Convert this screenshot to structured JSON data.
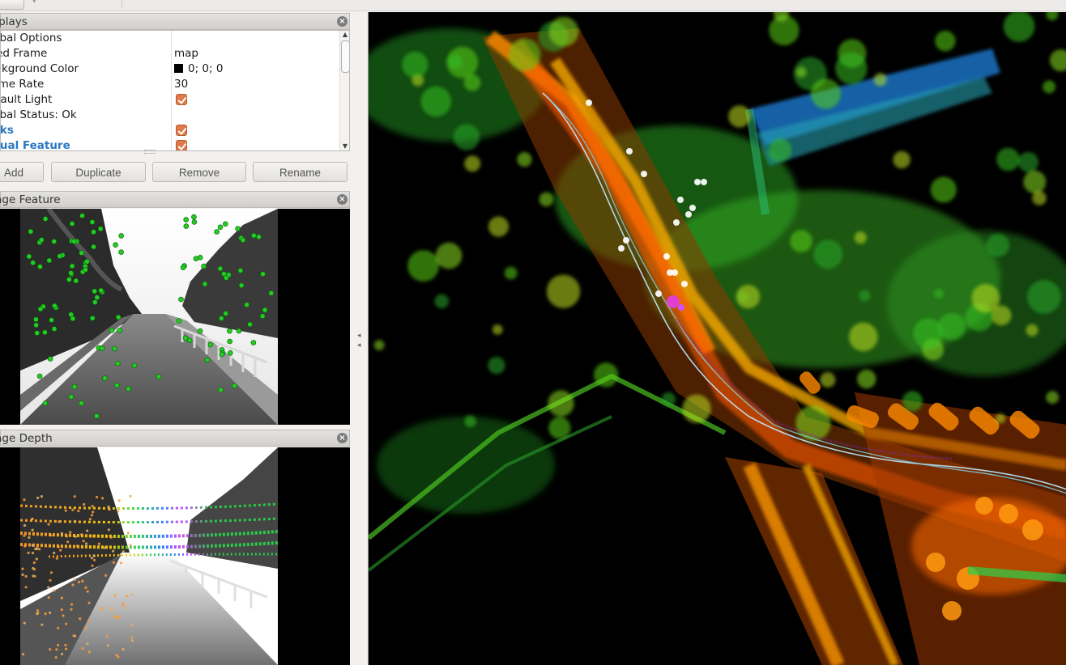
{
  "displays_panel": {
    "title": "Displays",
    "tree": [
      {
        "name": "Global Options",
        "value": "",
        "kind": "text"
      },
      {
        "name": "Fixed Frame",
        "value": "map",
        "kind": "text"
      },
      {
        "name": "Background Color",
        "value": "0; 0; 0",
        "kind": "color"
      },
      {
        "name": "Frame Rate",
        "value": "30",
        "kind": "text"
      },
      {
        "name": "Default Light",
        "value": "",
        "kind": "checkbox"
      },
      {
        "name": "Global Status: Ok",
        "value": "",
        "kind": "text"
      },
      {
        "name": "Links",
        "value": "",
        "kind": "checkbox",
        "link": true
      },
      {
        "name": "Visual Feature",
        "value": "",
        "kind": "checkbox",
        "link": true
      }
    ],
    "buttons": {
      "add": "Add",
      "duplicate": "Duplicate",
      "remove": "Remove",
      "rename": "Rename"
    }
  },
  "image_feature_panel": {
    "title": "Image Feature"
  },
  "image_depth_panel": {
    "title": "Image Depth"
  },
  "colors": {
    "checkbox": "#e07a4a",
    "link": "#2a77c3",
    "feature_point": "#22cc22"
  }
}
